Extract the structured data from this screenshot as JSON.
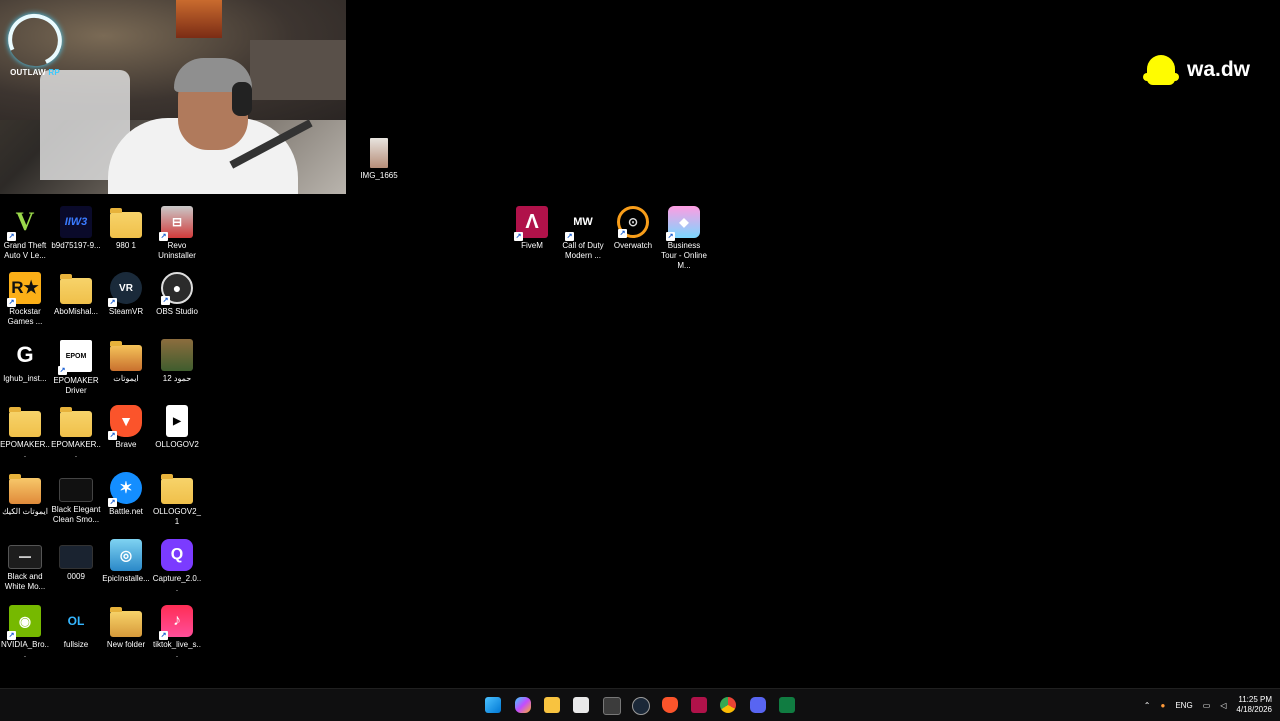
{
  "overlay": {
    "brand_name": "OUTLAW",
    "brand_suffix": "RP",
    "snap_handle": "wa.dw"
  },
  "desktop_icons": [
    {
      "label": "IMG_1665",
      "icon": "photo-thumbnail-icon"
    },
    {
      "label": "Grand Theft Auto V Le...",
      "icon": "gta-v-icon"
    },
    {
      "label": "b9d75197-9...",
      "icon": "image-file-icon"
    },
    {
      "label": "980 1",
      "icon": "folder-icon"
    },
    {
      "label": "Revo Uninstaller",
      "icon": "revo-uninstaller-icon"
    },
    {
      "label": "Rockstar Games ...",
      "icon": "rockstar-icon"
    },
    {
      "label": "AboMishal...",
      "icon": "folder-icon"
    },
    {
      "label": "SteamVR",
      "icon": "steamvr-icon"
    },
    {
      "label": "OBS Studio",
      "icon": "obs-icon"
    },
    {
      "label": "lghub_inst...",
      "icon": "logitech-g-icon"
    },
    {
      "label": "EPOMAKER Driver",
      "icon": "epomaker-icon"
    },
    {
      "label": "ايموتات",
      "icon": "folder-icon"
    },
    {
      "label": "حمود 12",
      "icon": "photo-thumbnail-icon"
    },
    {
      "label": "EPOMAKER...",
      "icon": "folder-icon"
    },
    {
      "label": "EPOMAKER...",
      "icon": "folder-icon"
    },
    {
      "label": "Brave",
      "icon": "brave-icon"
    },
    {
      "label": "OLLOGOV2",
      "icon": "video-file-icon"
    },
    {
      "label": "ايموتات الكيك",
      "icon": "folder-icon"
    },
    {
      "label": "Black Elegant Clean Smo...",
      "icon": "video-thumbnail-icon"
    },
    {
      "label": "Battle.net",
      "icon": "battlenet-icon"
    },
    {
      "label": "OLLOGOV2_1",
      "icon": "folder-icon"
    },
    {
      "label": "Black and White Mo...",
      "icon": "video-thumbnail-icon"
    },
    {
      "label": "0009",
      "icon": "video-thumbnail-icon"
    },
    {
      "label": "EpicInstalle...",
      "icon": "installer-disc-icon"
    },
    {
      "label": "Capture_2.0...",
      "icon": "capture-app-icon"
    },
    {
      "label": "NVIDIA_Bro...",
      "icon": "nvidia-icon"
    },
    {
      "label": "fullsize",
      "icon": "image-file-icon"
    },
    {
      "label": "New folder",
      "icon": "folder-icon"
    },
    {
      "label": "tiktok_live_s...",
      "icon": "tiktok-icon"
    },
    {
      "label": "FiveM",
      "icon": "fivem-icon"
    },
    {
      "label": "Call of Duty Modern ...",
      "icon": "cod-mw-icon"
    },
    {
      "label": "Overwatch",
      "icon": "overwatch-icon"
    },
    {
      "label": "Business Tour - Online M...",
      "icon": "business-tour-icon"
    }
  ],
  "taskbar": {
    "apps": [
      "start-icon",
      "copilot-icon",
      "file-explorer-icon",
      "store-icon",
      "calculator-icon",
      "steam-icon",
      "brave-icon",
      "fivem-icon",
      "chrome-icon",
      "discord-icon",
      "excel-icon"
    ],
    "language": "ENG",
    "time": "11:25 PM",
    "date": "4/18/2026"
  }
}
